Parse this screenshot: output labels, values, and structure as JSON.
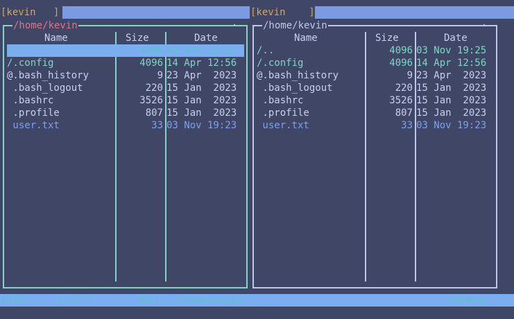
{
  "top_tabs": {
    "left": "[kevin   ]",
    "right": "[kevin    ]"
  },
  "left_panel": {
    "path": "/home/kevin",
    "corner_marker": "·",
    "columns": {
      "name": "Name",
      "size": "Size",
      "date": "Date"
    },
    "selected_index": 0,
    "files": [
      {
        "name": "/..",
        "size": "4096",
        "date": "03 Nov 19:25",
        "kind": "dir"
      },
      {
        "name": "/.config",
        "size": "4096",
        "date": "14 Apr 12:56",
        "kind": "dir"
      },
      {
        "name": "@.bash_history",
        "size": "9",
        "date": "23 Apr  2023",
        "kind": "file"
      },
      {
        "name": " .bash_logout",
        "size": "220",
        "date": "15 Jan  2023",
        "kind": "file"
      },
      {
        "name": " .bashrc",
        "size": "3526",
        "date": "15 Jan  2023",
        "kind": "file"
      },
      {
        "name": " .profile",
        "size": "807",
        "date": "15 Jan  2023",
        "kind": "file"
      },
      {
        "name": " user.txt",
        "size": "33",
        "date": "03 Nov 19:23",
        "kind": "new"
      }
    ]
  },
  "right_panel": {
    "path": "/home/kevin",
    "corner_marker": "·",
    "columns": {
      "name": "Name",
      "size": "Size",
      "date": "Date"
    },
    "files": [
      {
        "name": "/..",
        "size": "4096",
        "date": "03 Nov 19:25",
        "kind": "dir"
      },
      {
        "name": "/.config",
        "size": "4096",
        "date": "14 Apr 12:56",
        "kind": "dir"
      },
      {
        "name": "@.bash_history",
        "size": "9",
        "date": "23 Apr  2023",
        "kind": "file"
      },
      {
        "name": " .bash_logout",
        "size": "220",
        "date": "15 Jan  2023",
        "kind": "file"
      },
      {
        "name": " .bashrc",
        "size": "3526",
        "date": "15 Jan  2023",
        "kind": "file"
      },
      {
        "name": " .profile",
        "size": "807",
        "date": "15 Jan  2023",
        "kind": "file"
      },
      {
        "name": " user.txt",
        "size": "33",
        "date": "03 Nov 19:23",
        "kind": "new"
      }
    ]
  },
  "status_bar": {
    "file_label": "File:",
    "position": "1 of 7",
    "path_label": "Path:",
    "path_value": "/home/kevin/..",
    "help": "h=Help"
  },
  "colors": {
    "background": "#3f4666",
    "accent_bar": "#7aaef0",
    "left_frame": "#7fd7c5",
    "right_frame": "#bfc8ea",
    "directory": "#7fd7c5",
    "file": "#c9d1ee",
    "new_file": "#7fa0ee",
    "tab_text": "#e0a24c",
    "active_path": "#e37386"
  }
}
